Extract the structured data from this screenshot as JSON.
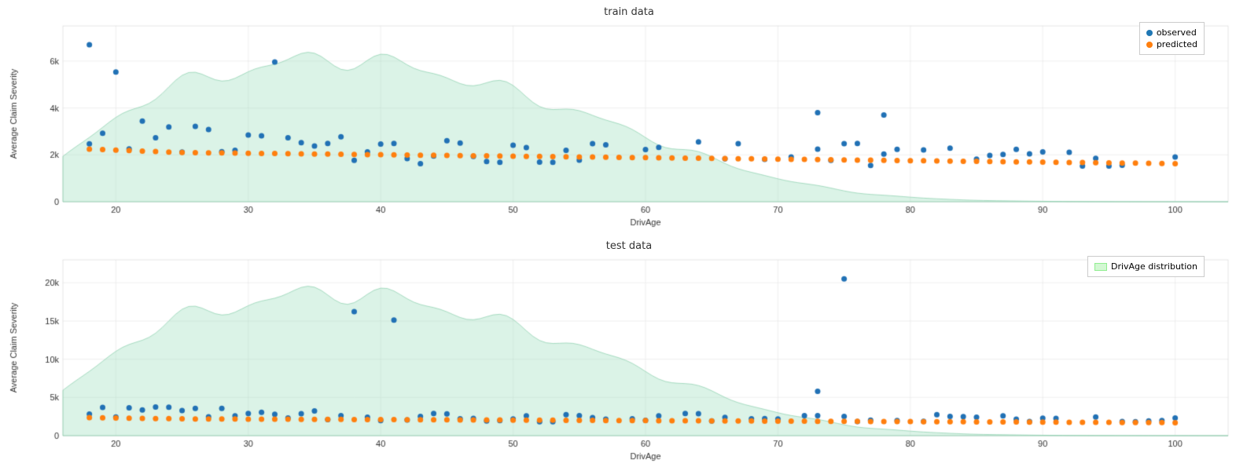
{
  "charts": [
    {
      "id": "train",
      "title": "train data",
      "xLabel": "DrivAge",
      "yLabel": "Average Claim Severity",
      "yMax": 7000,
      "yTicks": [
        0,
        2000,
        4000,
        6000
      ],
      "xMin": 18,
      "xMax": 103,
      "xTicks": [
        20,
        30,
        40,
        50,
        60,
        70,
        80,
        90,
        100
      ],
      "legend": [
        {
          "label": "observed",
          "color": "#1f77b4",
          "type": "dot"
        },
        {
          "label": "predicted",
          "color": "#ff7f0e",
          "type": "dot"
        }
      ],
      "distributionLabel": null
    },
    {
      "id": "test",
      "title": "test data",
      "xLabel": "DrivAge",
      "yLabel": "Average Claim Severity",
      "yMax": 22000,
      "yTicks": [
        0,
        5000,
        10000,
        15000,
        20000
      ],
      "xMin": 18,
      "xMax": 103,
      "xTicks": [
        20,
        30,
        40,
        50,
        60,
        70,
        80,
        90,
        100
      ],
      "legend": [
        {
          "label": "DrivAge distribution",
          "color": "rgba(144,238,144,0.4)",
          "type": "rect"
        }
      ],
      "distributionLabel": "DrivAge distribution"
    }
  ]
}
